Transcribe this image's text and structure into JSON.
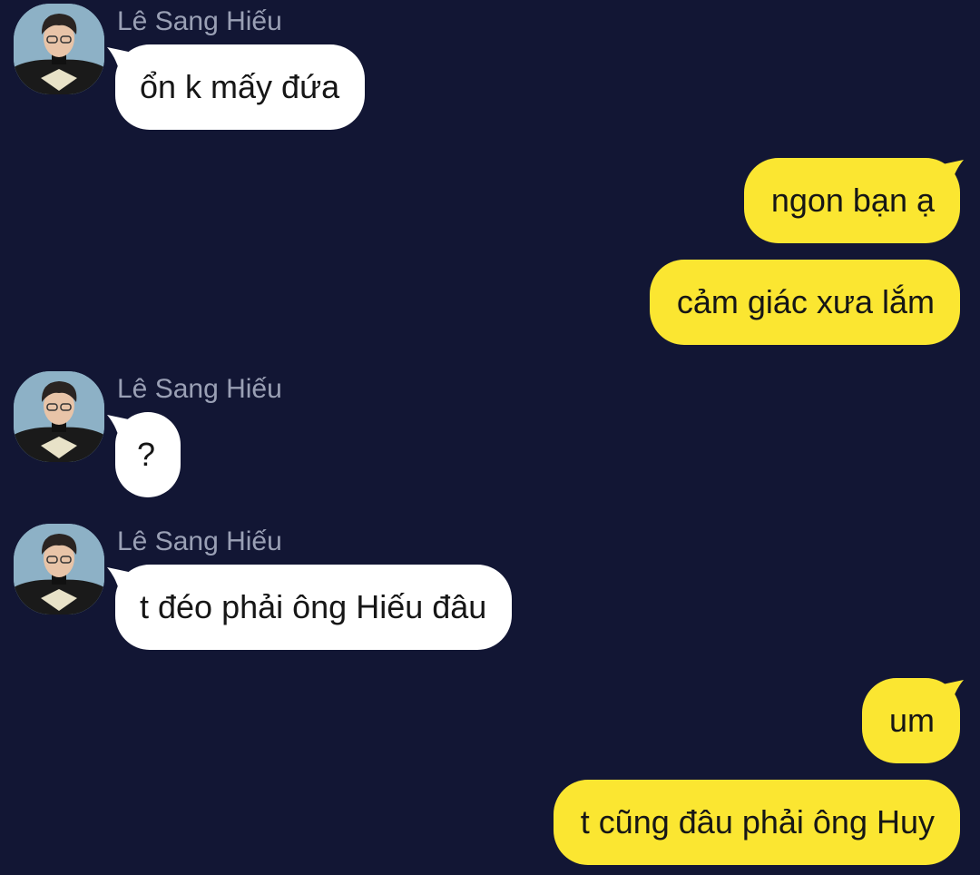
{
  "messages": [
    {
      "side": "in",
      "sender": "Lê Sang Hiếu",
      "text": "ổn k mấy đứa"
    },
    {
      "side": "out",
      "text": "ngon bạn ạ"
    },
    {
      "side": "out",
      "text": "cảm giác xưa lắm"
    },
    {
      "side": "in",
      "sender": "Lê Sang Hiếu",
      "text": "?"
    },
    {
      "side": "in",
      "sender": "Lê Sang Hiếu",
      "text": "t đéo phải ông Hiếu đâu"
    },
    {
      "side": "out",
      "text": "um"
    },
    {
      "side": "out",
      "text": "t cũng đâu phải ông Huy"
    }
  ],
  "colors": {
    "background": "#121634",
    "incoming_bubble": "#ffffff",
    "outgoing_bubble": "#fbe631",
    "sender_name": "#9aa0b5"
  },
  "icons": {
    "avatar": "user-avatar-photo"
  }
}
